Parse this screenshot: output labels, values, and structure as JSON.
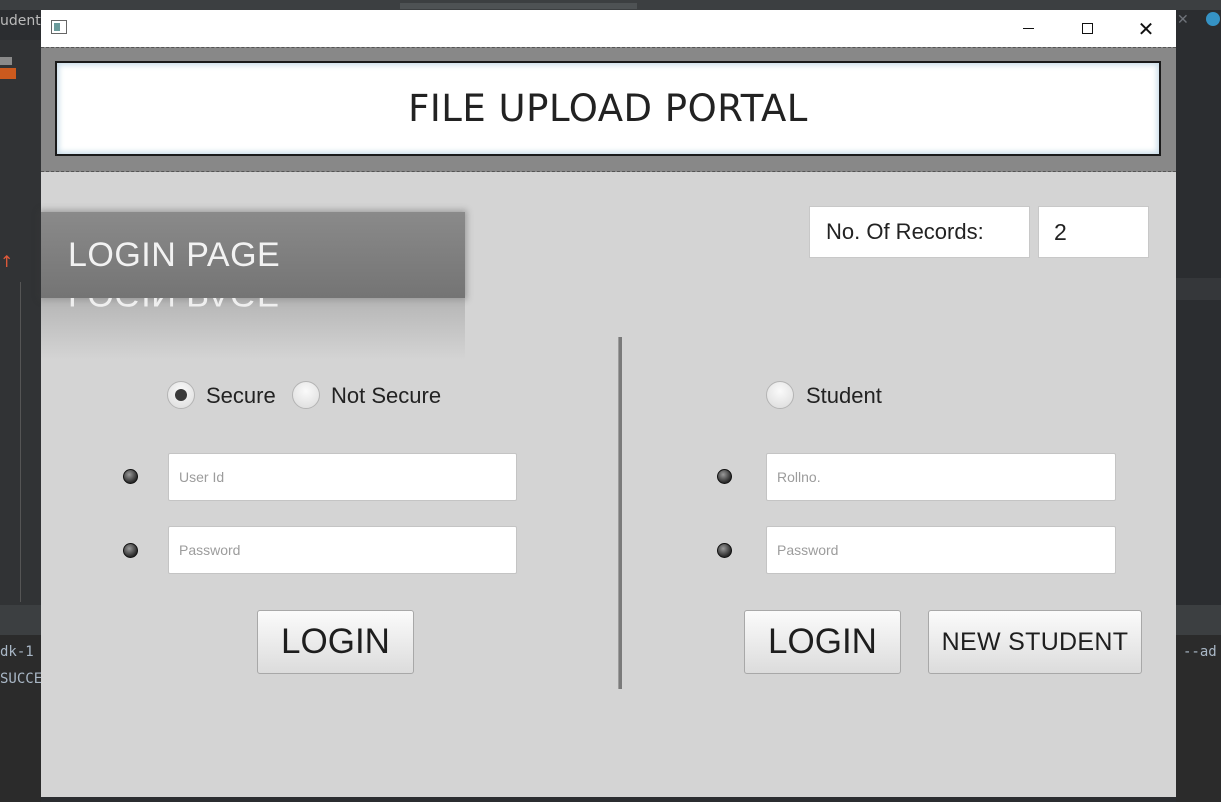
{
  "background": {
    "tab_fragment": "udent.",
    "console_line1": "dk-1",
    "console_line2": "SUCCE",
    "console_right": "--ad"
  },
  "window": {
    "controls": {
      "minimize": "minimize-icon",
      "maximize": "maximize-icon",
      "close": "close-icon"
    }
  },
  "header": {
    "title": "FILE UPLOAD PORTAL"
  },
  "login_banner": {
    "text": "LOGIN PAGE"
  },
  "records": {
    "label": "No. Of Records:",
    "value": "2"
  },
  "left_panel": {
    "radios": [
      {
        "label": "Secure",
        "selected": true
      },
      {
        "label": "Not Secure",
        "selected": false
      }
    ],
    "user_id_placeholder": "User Id",
    "password_placeholder": "Password",
    "login_label": "LOGIN"
  },
  "right_panel": {
    "radio": {
      "label": "Student",
      "selected": false
    },
    "rollno_placeholder": "Rollno.",
    "password_placeholder": "Password",
    "login_label": "LOGIN",
    "new_student_label": "NEW STUDENT"
  },
  "colors": {
    "window_bg": "#d4d4d4",
    "header_bg": "#888888",
    "banner_bg": "#808080"
  }
}
